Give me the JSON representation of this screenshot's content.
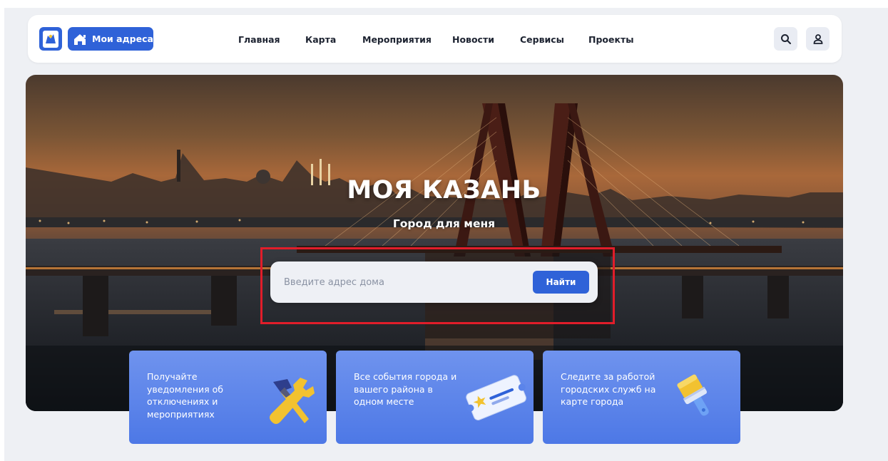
{
  "header": {
    "logo_alt": "Kazan coat of arms",
    "my_addresses_label": "Мои адреса",
    "nav": [
      {
        "label": "Главная"
      },
      {
        "label": "Карта"
      },
      {
        "label": "Мероприятия"
      },
      {
        "label": "Новости"
      },
      {
        "label": "Сервисы"
      },
      {
        "label": "Проекты"
      }
    ],
    "search_icon": "search-icon",
    "profile_icon": "user-icon"
  },
  "hero": {
    "title": "МОЯ КАЗАНЬ",
    "subtitle": "Город для меня",
    "search_placeholder": "Введите адрес дома",
    "search_value": "",
    "search_button": "Найти"
  },
  "cards": [
    {
      "text": "Получайте уведомления об отключениях и мероприятиях",
      "icon": "tools-icon"
    },
    {
      "text": "Все события города и вашего района в одном месте",
      "icon": "ticket-icon"
    },
    {
      "text": "Следите за работой городских служб на карте города",
      "icon": "paint-brush-icon"
    }
  ],
  "colors": {
    "accent": "#2f62d8",
    "card": "#5b84ea",
    "highlight": "#e11d2a",
    "page_bg": "#eef0f4"
  }
}
